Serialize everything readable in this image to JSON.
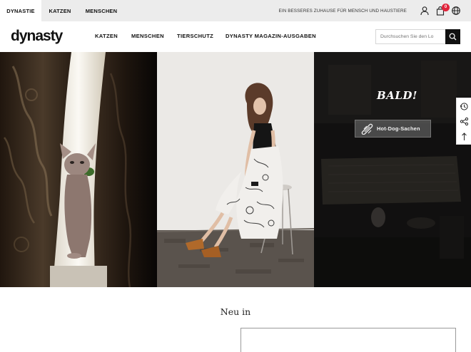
{
  "topbar": {
    "tabs": [
      {
        "label": "DYNASTIE",
        "active": true
      },
      {
        "label": "KATZEN",
        "active": false
      },
      {
        "label": "MENSCHEN",
        "active": false
      }
    ],
    "slogan": "EIN BESSERES ZUHAUSE FÜR MENSCH UND HAUSTIERE",
    "icons": [
      "user-icon",
      "cart-icon",
      "globe-icon"
    ],
    "cart_count": "0"
  },
  "header": {
    "logo": "dynasty",
    "nav": [
      "KATZEN",
      "MENSCHEN",
      "TIERSCHUTZ",
      "DYNASTY MAGAZIN-AUSGABEN"
    ],
    "search_placeholder": "Durchsuchen Sie den Lo",
    "search_icon": "search-icon"
  },
  "hero": {
    "panels": [
      {
        "scene": "hairless cat peeking between curtains",
        "palette": "#0c0907"
      },
      {
        "scene": "woman in floral dress seated on stool",
        "palette": "#e6e4e1"
      },
      {
        "scene": "dim living room",
        "palette": "#1c1c1b"
      }
    ],
    "coming_soon": "BALD!",
    "hotdog_label": "Hot-Dog-Sachen"
  },
  "sidetools": [
    "recently-viewed-icon",
    "share-icon",
    "back-to-top-icon"
  ],
  "section": {
    "title": "Neu in"
  },
  "colors": {
    "accent_badge": "#e0243b",
    "search_button": "#111111",
    "topbar_bg": "#ececec"
  }
}
